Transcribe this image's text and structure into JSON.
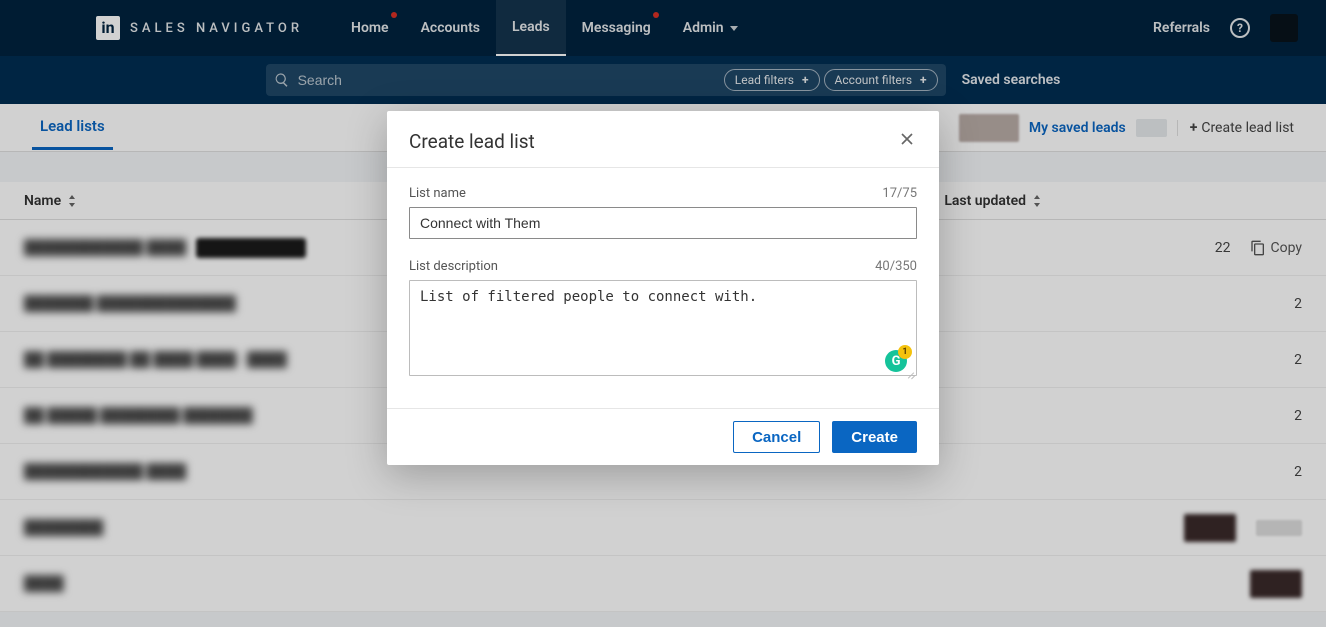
{
  "brand": {
    "logo_letter": "in",
    "product_name": "SALES NAVIGATOR"
  },
  "nav": {
    "home": "Home",
    "accounts": "Accounts",
    "leads": "Leads",
    "messaging": "Messaging",
    "admin": "Admin",
    "referrals": "Referrals"
  },
  "search": {
    "placeholder": "Search",
    "lead_filters": "Lead filters",
    "account_filters": "Account filters",
    "saved_searches": "Saved searches"
  },
  "subheader": {
    "tab_lead_lists": "Lead lists",
    "my_saved_leads": "My saved leads",
    "create_lead_list": "Create lead list"
  },
  "table": {
    "col_name": "Name",
    "col_updated": "Last updated",
    "row0_trailing": "22",
    "action_copy": "Copy",
    "row_trailing_2": "2"
  },
  "blur": {
    "r0": "████████████ ████",
    "r1": "███████ ██████████████",
    "r2": "██ ████████ ██ ████ ████ - ████",
    "r3": "██ █████ ████████ ███████",
    "r4": "████████████ ████",
    "r5": "████████"
  },
  "modal": {
    "title": "Create lead list",
    "list_name_label": "List name",
    "list_name_count": "17/75",
    "list_name_value": "Connect with Them",
    "list_desc_label": "List description",
    "list_desc_count": "40/350",
    "list_desc_value": "List of filtered people to connect with.",
    "grammarly_badge": "1",
    "cancel": "Cancel",
    "create": "Create"
  }
}
